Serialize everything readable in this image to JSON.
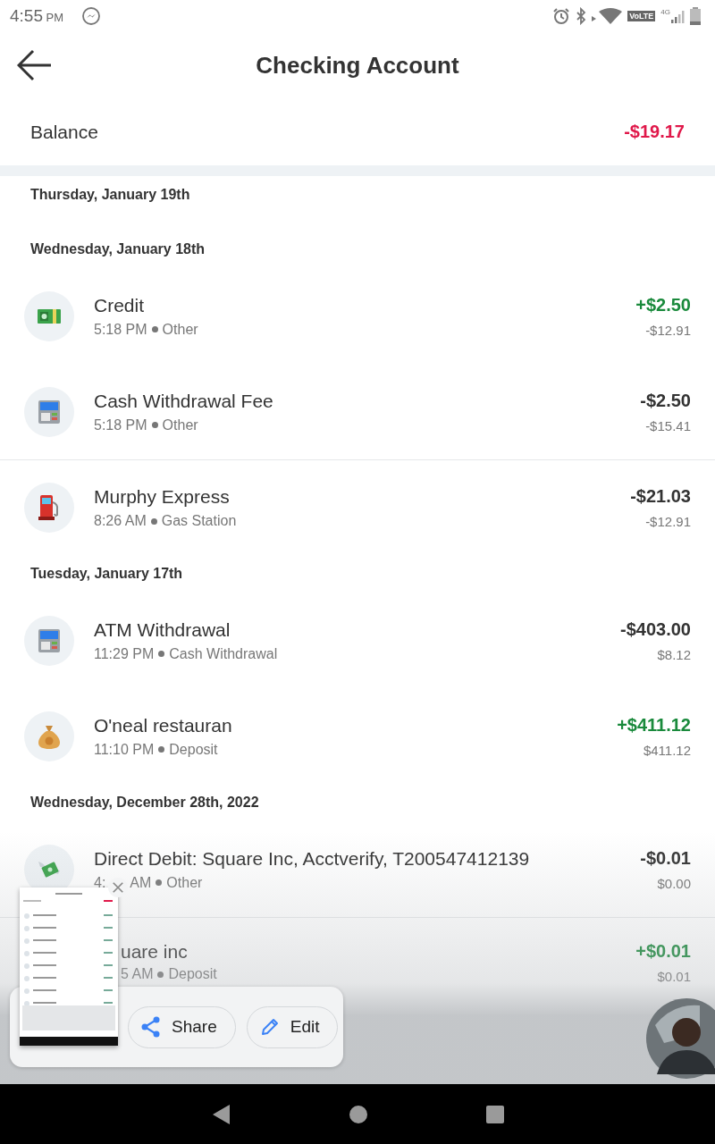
{
  "status_bar": {
    "time": "4:55",
    "ampm": "PM",
    "network_badge": "VoLTE",
    "network_type": "4G"
  },
  "header": {
    "title": "Checking Account"
  },
  "balance": {
    "label": "Balance",
    "amount": "-$19.17"
  },
  "sections": [
    {
      "date": "Thursday, January 19th"
    },
    {
      "date": "Wednesday, January 18th",
      "transactions": [
        {
          "kind": "cash",
          "title": "Credit",
          "time": "5:18 PM",
          "category": "Other",
          "amount": "+$2.50",
          "positive": true,
          "running_balance": "-$12.91",
          "divider_above": false
        },
        {
          "kind": "atm",
          "title": "Cash Withdrawal Fee",
          "time": "5:18 PM",
          "category": "Other",
          "amount": "-$2.50",
          "positive": false,
          "running_balance": "-$15.41",
          "divider_above": false
        },
        {
          "kind": "fuel",
          "title": "Murphy Express",
          "time": "8:26 AM",
          "category": "Gas Station",
          "amount": "-$21.03",
          "positive": false,
          "running_balance": "-$12.91",
          "divider_above": true
        }
      ]
    },
    {
      "date": "Tuesday, January 17th",
      "transactions": [
        {
          "kind": "atm",
          "title": "ATM Withdrawal",
          "time": "11:29 PM",
          "category": "Cash Withdrawal",
          "amount": "-$403.00",
          "positive": false,
          "running_balance": "$8.12",
          "divider_above": false
        },
        {
          "kind": "bag",
          "title": "O'neal restauran",
          "time": "11:10 PM",
          "category": "Deposit",
          "amount": "+$411.12",
          "positive": true,
          "running_balance": "$411.12",
          "divider_above": false
        }
      ]
    },
    {
      "date": "Wednesday, December 28th, 2022",
      "transactions": [
        {
          "kind": "wings",
          "title": "Direct Debit: Square Inc, Acctverify, T200547412139",
          "time": "4:",
          "time_after_close_button": "AM",
          "category": "Other",
          "amount": "-$0.01",
          "positive": false,
          "running_balance": "$0.00",
          "divider_above": false
        },
        {
          "kind": "hidden",
          "title": "uare inc",
          "time": "5 AM",
          "category": "Deposit",
          "amount": "+$0.01",
          "positive": true,
          "running_balance": "$0.01",
          "divider_above": true
        }
      ]
    }
  ],
  "share_panel": {
    "buttons": [
      {
        "kind": "share",
        "label": "Share"
      },
      {
        "kind": "edit",
        "label": "Edit"
      }
    ]
  }
}
